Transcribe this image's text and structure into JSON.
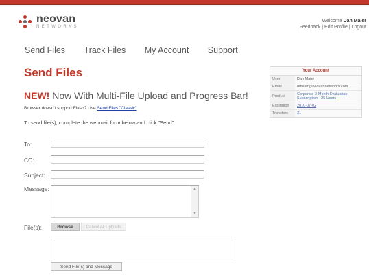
{
  "brand": {
    "name": "neovan",
    "sub": "NETWORKS",
    "colors": {
      "accent": "#c0392b",
      "link": "#2244aa"
    }
  },
  "header": {
    "welcome_prefix": "Welcome",
    "user_name": "Dan Maier",
    "links": "Feedback | Edit Profile | Logout"
  },
  "nav": {
    "items": [
      "Send Files",
      "Track Files",
      "My Account",
      "Support"
    ]
  },
  "main": {
    "title": "Send Files",
    "new_tag": "NEW!",
    "subtitle": "Now With Multi-File Upload and Progress Bar!",
    "flash_note": "Browser doesn't support Flash? Use",
    "flash_link": "Send Files \"Classic\"",
    "instructions": "To send file(s), complete the webmail form below and click \"Send\".",
    "labels": {
      "to": "To:",
      "cc": "CC:",
      "subject": "Subject:",
      "message": "Message:",
      "files": "File(s):"
    },
    "buttons": {
      "browse": "Browse",
      "cancel": "Cancel All Uploads",
      "send": "Send File(s) and Message"
    }
  },
  "account": {
    "title": "Your Account",
    "rows": [
      {
        "key": "User",
        "value": "Dan Maier"
      },
      {
        "key": "Email",
        "value": "dmaier@neovannetworks.com"
      },
      {
        "key": "Product",
        "value": "Corporate 3-Month Evaluation Subscription - 25 Users"
      },
      {
        "key": "Expiration",
        "value": "2010-07-02"
      },
      {
        "key": "Transfers",
        "value": "31"
      }
    ]
  }
}
